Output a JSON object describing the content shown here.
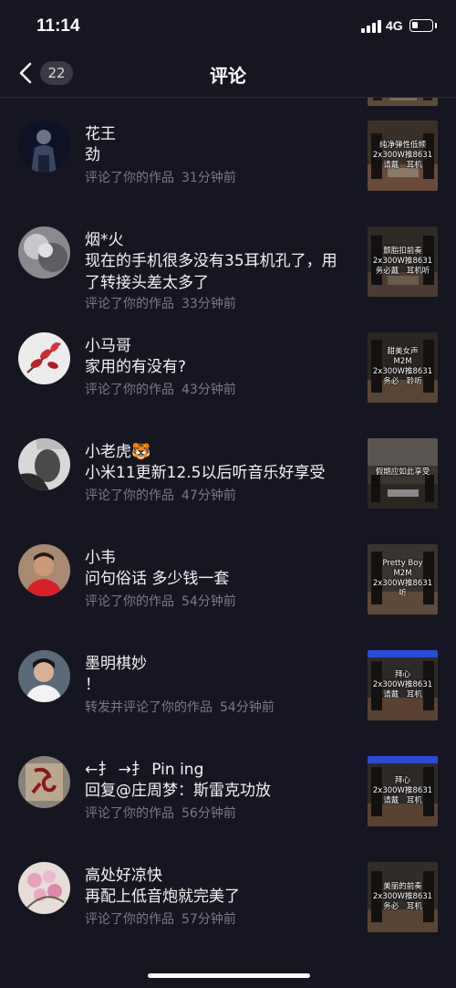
{
  "status_bar": {
    "time": "11:14",
    "network": "4G",
    "battery_level": 0.3
  },
  "header": {
    "title": "评论",
    "back_count": "22"
  },
  "colors": {
    "background": "#161622",
    "text_primary": "#f2f2f5",
    "text_secondary": "#7a7a86",
    "badge_bg": "#3a3a46"
  },
  "comments": [
    {
      "user": "",
      "text": "",
      "action": "",
      "time": "",
      "thumb_caption": []
    },
    {
      "user": "花王",
      "text": "劲",
      "action": "评论了你的作品",
      "time": "31分钟前",
      "thumb_caption": [
        "纯净弹性低频",
        "2x300W推8631",
        "请戴　耳机"
      ]
    },
    {
      "user": "烟*火",
      "text": "现在的手机很多没有35耳机孔了，用了转接头差太多了",
      "action": "评论了你的作品",
      "time": "33分钟前",
      "thumb_caption": [
        "颤脂扣前奏",
        "2x300W推8631",
        "务必戴　耳机听"
      ]
    },
    {
      "user": "小马哥",
      "text": "家用的有没有?",
      "action": "评论了你的作品",
      "time": "43分钟前",
      "thumb_caption": [
        "甜美女声",
        "M2M",
        "2x300W推8631",
        "务必　聆听"
      ]
    },
    {
      "user": "小老虎🐯",
      "text": "小米11更新12.5以后听音乐好享受",
      "action": "评论了你的作品",
      "time": "47分钟前",
      "thumb_caption": [
        "假期应如此享受"
      ]
    },
    {
      "user": "小韦",
      "text": "问句俗话 多少钱一套",
      "action": "评论了你的作品",
      "time": "54分钟前",
      "thumb_caption": [
        "Pretty Boy",
        "M2M",
        "2x300W推8631",
        "听"
      ]
    },
    {
      "user": "墨明棋妙",
      "text": "！",
      "action": "转发并评论了你的作品",
      "time": "54分钟前",
      "thumb_caption": [
        "拜心",
        "2x300W推8631",
        "请戴　耳机"
      ]
    },
    {
      "user": "←扌 →扌 Pin ing",
      "text": "回复@庄周梦：斯雷克功放",
      "action": "评论了你的作品",
      "time": "56分钟前",
      "thumb_caption": [
        "拜心",
        "2x300W推8631",
        "请戴　耳机"
      ]
    },
    {
      "user": "高处好凉快",
      "text": "再配上低音炮就完美了",
      "action": "评论了你的作品",
      "time": "57分钟前",
      "thumb_caption": [
        "美丽的前奏",
        "2x300W推8631",
        "务必　耳机"
      ]
    }
  ]
}
